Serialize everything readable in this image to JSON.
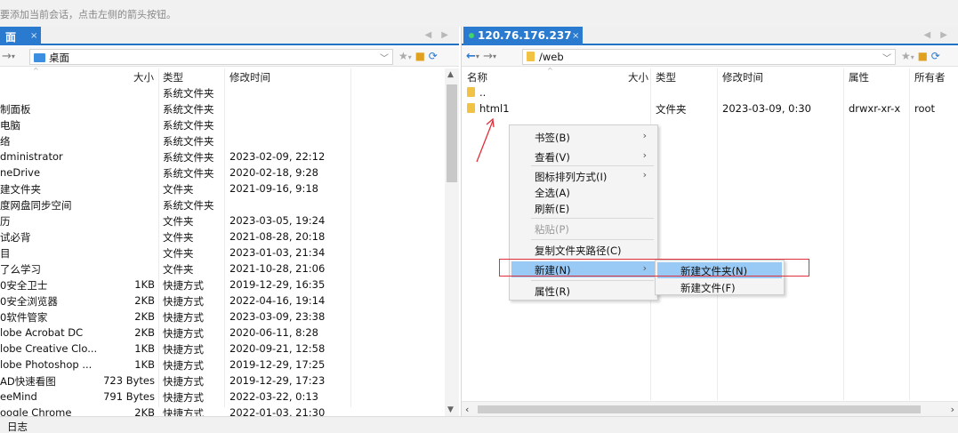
{
  "hint_text": "要添加当前会话，点击左侧的箭头按钮。",
  "left": {
    "tab_label": "面",
    "tab_close": "×",
    "path": "桌面",
    "columns": [
      "大小",
      "类型",
      "修改时间"
    ],
    "rows": [
      {
        "name": "",
        "size": "",
        "type": "系统文件夹",
        "date": ""
      },
      {
        "name": "制面板",
        "size": "",
        "type": "系统文件夹",
        "date": ""
      },
      {
        "name": "电脑",
        "size": "",
        "type": "系统文件夹",
        "date": ""
      },
      {
        "name": "络",
        "size": "",
        "type": "系统文件夹",
        "date": ""
      },
      {
        "name": "dministrator",
        "size": "",
        "type": "系统文件夹",
        "date": "2023-02-09, 22:12"
      },
      {
        "name": "neDrive",
        "size": "",
        "type": "系统文件夹",
        "date": "2020-02-18, 9:28"
      },
      {
        "name": "建文件夹",
        "size": "",
        "type": "文件夹",
        "date": "2021-09-16, 9:18"
      },
      {
        "name": "度网盘同步空间",
        "size": "",
        "type": "系统文件夹",
        "date": ""
      },
      {
        "name": "历",
        "size": "",
        "type": "文件夹",
        "date": "2023-03-05, 19:24"
      },
      {
        "name": "试必背",
        "size": "",
        "type": "文件夹",
        "date": "2021-08-28, 20:18"
      },
      {
        "name": "目",
        "size": "",
        "type": "文件夹",
        "date": "2023-01-03, 21:34"
      },
      {
        "name": "了么学习",
        "size": "",
        "type": "文件夹",
        "date": "2021-10-28, 21:06"
      },
      {
        "name": "0安全卫士",
        "size": "1KB",
        "type": "快捷方式",
        "date": "2019-12-29, 16:35"
      },
      {
        "name": "0安全浏览器",
        "size": "2KB",
        "type": "快捷方式",
        "date": "2022-04-16, 19:14"
      },
      {
        "name": "0软件管家",
        "size": "2KB",
        "type": "快捷方式",
        "date": "2023-03-09, 23:38"
      },
      {
        "name": "lobe Acrobat DC",
        "size": "2KB",
        "type": "快捷方式",
        "date": "2020-06-11, 8:28"
      },
      {
        "name": "lobe Creative Clo...",
        "size": "1KB",
        "type": "快捷方式",
        "date": "2020-09-21, 12:58"
      },
      {
        "name": "lobe Photoshop ...",
        "size": "1KB",
        "type": "快捷方式",
        "date": "2019-12-29, 17:25"
      },
      {
        "name": "AD快速看图",
        "size": "723 Bytes",
        "type": "快捷方式",
        "date": "2019-12-29, 17:23"
      },
      {
        "name": "eeMind",
        "size": "791 Bytes",
        "type": "快捷方式",
        "date": "2022-03-22, 0:13"
      },
      {
        "name": "oogle Chrome",
        "size": "2KB",
        "type": "快捷方式",
        "date": "2022-01-03, 21:30"
      }
    ]
  },
  "right": {
    "tab_label": "120.76.176.237",
    "tab_close": "×",
    "path": "/web",
    "columns": [
      "名称",
      "大小",
      "类型",
      "修改时间",
      "属性",
      "所有者"
    ],
    "rows": [
      {
        "name": "..",
        "size": "",
        "type": "",
        "date": "",
        "attr": "",
        "owner": ""
      },
      {
        "name": "html1",
        "size": "",
        "type": "文件夹",
        "date": "2023-03-09, 0:30",
        "attr": "drwxr-xr-x",
        "owner": "root"
      }
    ]
  },
  "context_menu": {
    "items": [
      {
        "label": "书签(B)",
        "submenu": true,
        "disabled": false
      },
      {
        "label": "查看(V)",
        "submenu": true,
        "disabled": false
      },
      {
        "label": "图标排列方式(I)",
        "submenu": true,
        "disabled": false
      },
      {
        "label": "全选(A)",
        "submenu": false,
        "disabled": false
      },
      {
        "label": "刷新(E)",
        "submenu": false,
        "disabled": false
      },
      {
        "label": "粘贴(P)",
        "submenu": false,
        "disabled": true
      },
      {
        "label": "复制文件夹路径(C)",
        "submenu": false,
        "disabled": false
      },
      {
        "label": "新建(N)",
        "submenu": true,
        "disabled": false,
        "highlighted": true
      },
      {
        "label": "属性(R)",
        "submenu": false,
        "disabled": false
      }
    ]
  },
  "submenu": {
    "items": [
      {
        "label": "新建文件夹(N)",
        "highlighted": true
      },
      {
        "label": "新建文件(F)",
        "highlighted": false
      }
    ]
  },
  "log_label": "日志",
  "colors": {
    "tab_blue": "#2a7bd0",
    "highlight": "#99c9f5",
    "annotation_red": "#e0303a",
    "folder_yellow": "#f2c244"
  },
  "icons": {
    "submenu_arrow": "›",
    "back": "←",
    "forward": "→",
    "dropdown": "﹀"
  }
}
